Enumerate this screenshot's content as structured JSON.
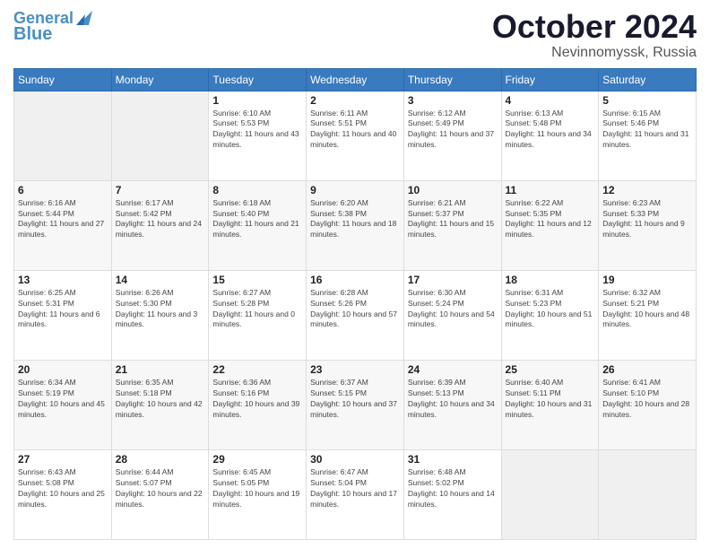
{
  "header": {
    "logo_line1": "General",
    "logo_line2": "Blue",
    "month": "October 2024",
    "location": "Nevinnomyssk, Russia"
  },
  "weekdays": [
    "Sunday",
    "Monday",
    "Tuesday",
    "Wednesday",
    "Thursday",
    "Friday",
    "Saturday"
  ],
  "weeks": [
    [
      {
        "day": "",
        "sunrise": "",
        "sunset": "",
        "daylight": ""
      },
      {
        "day": "",
        "sunrise": "",
        "sunset": "",
        "daylight": ""
      },
      {
        "day": "1",
        "sunrise": "Sunrise: 6:10 AM",
        "sunset": "Sunset: 5:53 PM",
        "daylight": "Daylight: 11 hours and 43 minutes."
      },
      {
        "day": "2",
        "sunrise": "Sunrise: 6:11 AM",
        "sunset": "Sunset: 5:51 PM",
        "daylight": "Daylight: 11 hours and 40 minutes."
      },
      {
        "day": "3",
        "sunrise": "Sunrise: 6:12 AM",
        "sunset": "Sunset: 5:49 PM",
        "daylight": "Daylight: 11 hours and 37 minutes."
      },
      {
        "day": "4",
        "sunrise": "Sunrise: 6:13 AM",
        "sunset": "Sunset: 5:48 PM",
        "daylight": "Daylight: 11 hours and 34 minutes."
      },
      {
        "day": "5",
        "sunrise": "Sunrise: 6:15 AM",
        "sunset": "Sunset: 5:46 PM",
        "daylight": "Daylight: 11 hours and 31 minutes."
      }
    ],
    [
      {
        "day": "6",
        "sunrise": "Sunrise: 6:16 AM",
        "sunset": "Sunset: 5:44 PM",
        "daylight": "Daylight: 11 hours and 27 minutes."
      },
      {
        "day": "7",
        "sunrise": "Sunrise: 6:17 AM",
        "sunset": "Sunset: 5:42 PM",
        "daylight": "Daylight: 11 hours and 24 minutes."
      },
      {
        "day": "8",
        "sunrise": "Sunrise: 6:18 AM",
        "sunset": "Sunset: 5:40 PM",
        "daylight": "Daylight: 11 hours and 21 minutes."
      },
      {
        "day": "9",
        "sunrise": "Sunrise: 6:20 AM",
        "sunset": "Sunset: 5:38 PM",
        "daylight": "Daylight: 11 hours and 18 minutes."
      },
      {
        "day": "10",
        "sunrise": "Sunrise: 6:21 AM",
        "sunset": "Sunset: 5:37 PM",
        "daylight": "Daylight: 11 hours and 15 minutes."
      },
      {
        "day": "11",
        "sunrise": "Sunrise: 6:22 AM",
        "sunset": "Sunset: 5:35 PM",
        "daylight": "Daylight: 11 hours and 12 minutes."
      },
      {
        "day": "12",
        "sunrise": "Sunrise: 6:23 AM",
        "sunset": "Sunset: 5:33 PM",
        "daylight": "Daylight: 11 hours and 9 minutes."
      }
    ],
    [
      {
        "day": "13",
        "sunrise": "Sunrise: 6:25 AM",
        "sunset": "Sunset: 5:31 PM",
        "daylight": "Daylight: 11 hours and 6 minutes."
      },
      {
        "day": "14",
        "sunrise": "Sunrise: 6:26 AM",
        "sunset": "Sunset: 5:30 PM",
        "daylight": "Daylight: 11 hours and 3 minutes."
      },
      {
        "day": "15",
        "sunrise": "Sunrise: 6:27 AM",
        "sunset": "Sunset: 5:28 PM",
        "daylight": "Daylight: 11 hours and 0 minutes."
      },
      {
        "day": "16",
        "sunrise": "Sunrise: 6:28 AM",
        "sunset": "Sunset: 5:26 PM",
        "daylight": "Daylight: 10 hours and 57 minutes."
      },
      {
        "day": "17",
        "sunrise": "Sunrise: 6:30 AM",
        "sunset": "Sunset: 5:24 PM",
        "daylight": "Daylight: 10 hours and 54 minutes."
      },
      {
        "day": "18",
        "sunrise": "Sunrise: 6:31 AM",
        "sunset": "Sunset: 5:23 PM",
        "daylight": "Daylight: 10 hours and 51 minutes."
      },
      {
        "day": "19",
        "sunrise": "Sunrise: 6:32 AM",
        "sunset": "Sunset: 5:21 PM",
        "daylight": "Daylight: 10 hours and 48 minutes."
      }
    ],
    [
      {
        "day": "20",
        "sunrise": "Sunrise: 6:34 AM",
        "sunset": "Sunset: 5:19 PM",
        "daylight": "Daylight: 10 hours and 45 minutes."
      },
      {
        "day": "21",
        "sunrise": "Sunrise: 6:35 AM",
        "sunset": "Sunset: 5:18 PM",
        "daylight": "Daylight: 10 hours and 42 minutes."
      },
      {
        "day": "22",
        "sunrise": "Sunrise: 6:36 AM",
        "sunset": "Sunset: 5:16 PM",
        "daylight": "Daylight: 10 hours and 39 minutes."
      },
      {
        "day": "23",
        "sunrise": "Sunrise: 6:37 AM",
        "sunset": "Sunset: 5:15 PM",
        "daylight": "Daylight: 10 hours and 37 minutes."
      },
      {
        "day": "24",
        "sunrise": "Sunrise: 6:39 AM",
        "sunset": "Sunset: 5:13 PM",
        "daylight": "Daylight: 10 hours and 34 minutes."
      },
      {
        "day": "25",
        "sunrise": "Sunrise: 6:40 AM",
        "sunset": "Sunset: 5:11 PM",
        "daylight": "Daylight: 10 hours and 31 minutes."
      },
      {
        "day": "26",
        "sunrise": "Sunrise: 6:41 AM",
        "sunset": "Sunset: 5:10 PM",
        "daylight": "Daylight: 10 hours and 28 minutes."
      }
    ],
    [
      {
        "day": "27",
        "sunrise": "Sunrise: 6:43 AM",
        "sunset": "Sunset: 5:08 PM",
        "daylight": "Daylight: 10 hours and 25 minutes."
      },
      {
        "day": "28",
        "sunrise": "Sunrise: 6:44 AM",
        "sunset": "Sunset: 5:07 PM",
        "daylight": "Daylight: 10 hours and 22 minutes."
      },
      {
        "day": "29",
        "sunrise": "Sunrise: 6:45 AM",
        "sunset": "Sunset: 5:05 PM",
        "daylight": "Daylight: 10 hours and 19 minutes."
      },
      {
        "day": "30",
        "sunrise": "Sunrise: 6:47 AM",
        "sunset": "Sunset: 5:04 PM",
        "daylight": "Daylight: 10 hours and 17 minutes."
      },
      {
        "day": "31",
        "sunrise": "Sunrise: 6:48 AM",
        "sunset": "Sunset: 5:02 PM",
        "daylight": "Daylight: 10 hours and 14 minutes."
      },
      {
        "day": "",
        "sunrise": "",
        "sunset": "",
        "daylight": ""
      },
      {
        "day": "",
        "sunrise": "",
        "sunset": "",
        "daylight": ""
      }
    ]
  ]
}
